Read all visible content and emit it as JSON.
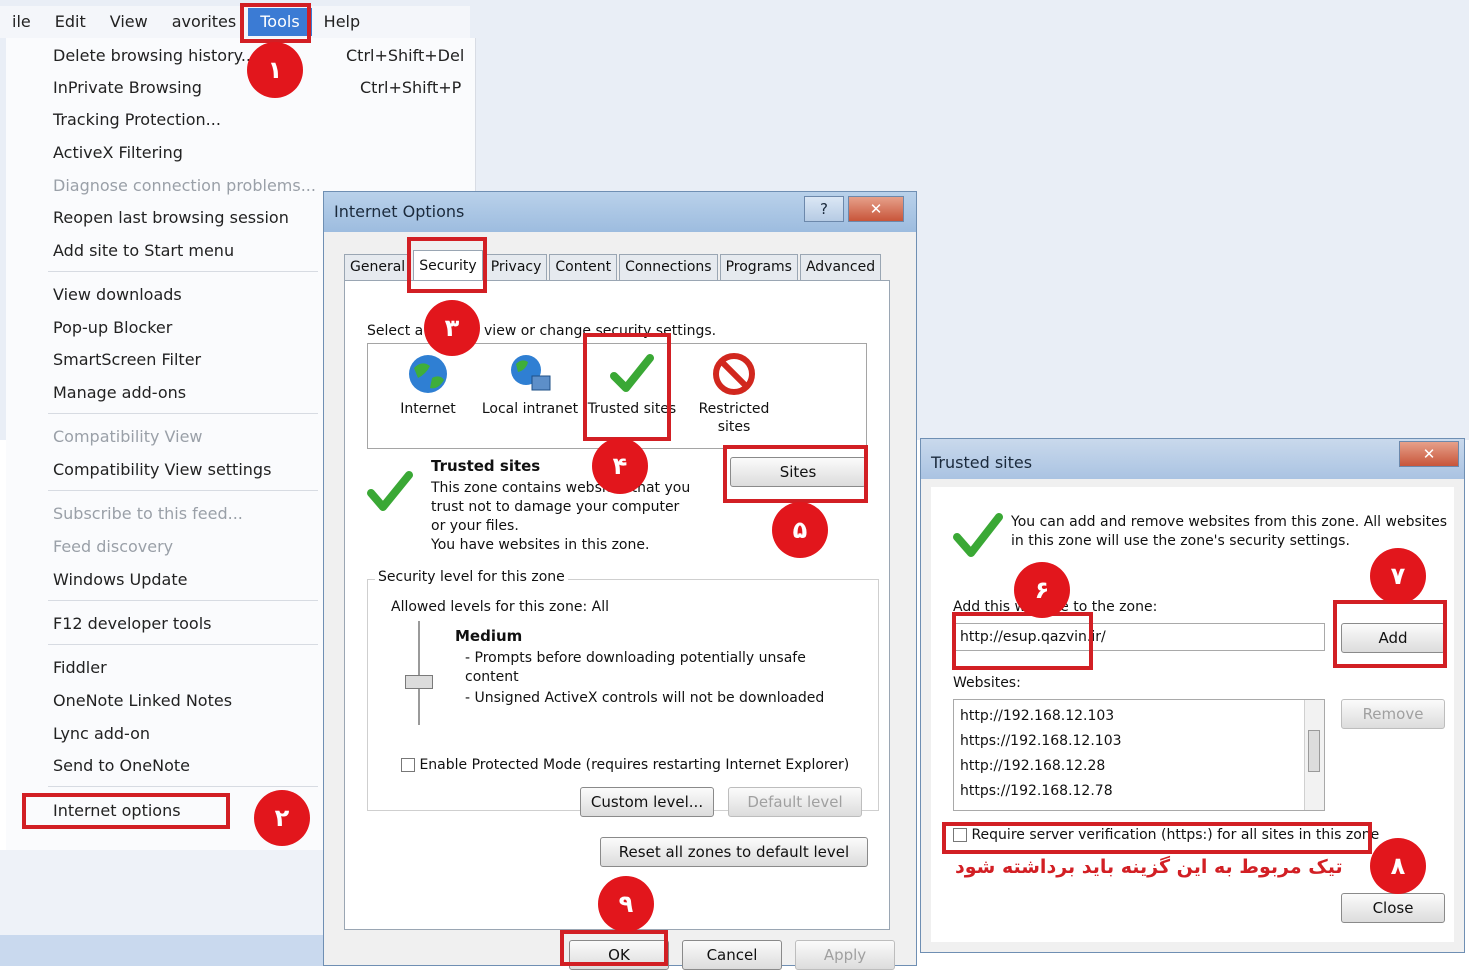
{
  "menubar": {
    "items": [
      "ile",
      "Edit",
      "View",
      "avorites",
      "Tools",
      "Help"
    ]
  },
  "tools_menu": {
    "items": [
      {
        "label": "Delete browsing history...",
        "shortcut": "Ctrl+Shift+Del"
      },
      {
        "label": "InPrivate Browsing",
        "shortcut": "Ctrl+Shift+P"
      },
      {
        "label": "Tracking Protection...",
        "shortcut": ""
      },
      {
        "label": "ActiveX Filtering",
        "shortcut": ""
      },
      {
        "label": "Diagnose connection problems...",
        "shortcut": ""
      },
      {
        "label": "Reopen last browsing session",
        "shortcut": ""
      },
      {
        "label": "Add site to Start menu",
        "shortcut": ""
      },
      {
        "label": "View downloads",
        "shortcut": ""
      },
      {
        "label": "Pop-up Blocker",
        "shortcut": ""
      },
      {
        "label": "SmartScreen Filter",
        "shortcut": ""
      },
      {
        "label": "Manage add-ons",
        "shortcut": ""
      },
      {
        "label": "Compatibility View",
        "shortcut": ""
      },
      {
        "label": "Compatibility View settings",
        "shortcut": ""
      },
      {
        "label": "Subscribe to this feed...",
        "shortcut": ""
      },
      {
        "label": "Feed discovery",
        "shortcut": ""
      },
      {
        "label": "Windows Update",
        "shortcut": ""
      },
      {
        "label": "F12 developer tools",
        "shortcut": ""
      },
      {
        "label": "Fiddler",
        "shortcut": ""
      },
      {
        "label": "OneNote Linked Notes",
        "shortcut": ""
      },
      {
        "label": "Lync add-on",
        "shortcut": ""
      },
      {
        "label": "Send to OneNote",
        "shortcut": ""
      },
      {
        "label": "Internet options",
        "shortcut": ""
      }
    ]
  },
  "internet_options": {
    "title": "Internet Options",
    "help_glyph": "?",
    "close_glyph": "✕",
    "tabs": [
      "General",
      "Security",
      "Privacy",
      "Content",
      "Connections",
      "Programs",
      "Advanced"
    ],
    "select_zone_text": "Select a zone to view or change security settings.",
    "zones": [
      "Internet",
      "Local intranet",
      "Trusted sites",
      "Restricted sites"
    ],
    "zone_title": "Trusted sites",
    "zone_desc": "This zone contains websites that you trust not to damage your computer or your files.",
    "zone_note": "You have websites in this zone.",
    "sites_button": "Sites",
    "security_level_title": "Security level for this zone",
    "allowed_levels": "Allowed levels for this zone: All",
    "level_name": "Medium",
    "level_points": [
      "- Prompts before downloading potentially unsafe content",
      "- Unsigned ActiveX controls will not be downloaded"
    ],
    "protected_mode": "Enable Protected Mode (requires restarting Internet Explorer)",
    "custom_level": "Custom level...",
    "default_level": "Default level",
    "reset_all": "Reset all zones to default level",
    "ok": "OK",
    "cancel": "Cancel",
    "apply": "Apply"
  },
  "trusted_sites": {
    "title": "Trusted sites",
    "close_glyph": "✕",
    "info": "You can add and remove websites from this zone. All websites in this zone will use the zone's security settings.",
    "add_label": "Add this website to the zone:",
    "add_value": "http://esup.qazvin.ir/",
    "add_button": "Add",
    "websites_label": "Websites:",
    "websites": [
      "http://192.168.12.103",
      "https://192.168.12.103",
      "http://192.168.12.28",
      "https://192.168.12.78"
    ],
    "remove_button": "Remove",
    "require_https": "Require server verification (https:) for all sites in this zone",
    "close_button": "Close"
  },
  "annotations": {
    "badges": [
      "۱",
      "۲",
      "۳",
      "۴",
      "۵",
      "۶",
      "۷",
      "۸",
      "۹"
    ],
    "note": "تیک مربوط به این گزینه باید برداشته شود",
    "color": "#d21f24"
  }
}
